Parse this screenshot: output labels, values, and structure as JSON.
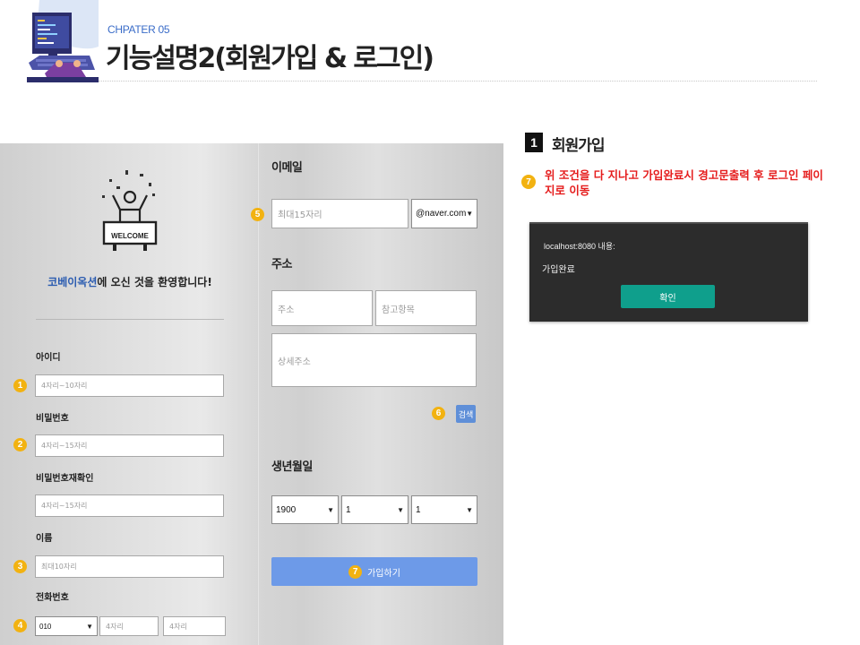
{
  "header": {
    "chapter": "CHPATER 05",
    "title": "기능설명2(회원가입 & 로그인)"
  },
  "signup_form": {
    "welcome_badge": "WELCOME",
    "welcome_brand": "코베이옥션",
    "welcome_rest": "에 오신 것을 환영합니다!",
    "fields": {
      "id": {
        "label": "아이디",
        "placeholder": "4자리~10자리",
        "badge": "1"
      },
      "password": {
        "label": "비밀번호",
        "placeholder": "4자리~15자리",
        "badge": "2"
      },
      "password_confirm": {
        "label": "비밀번호재확인",
        "placeholder": "4자리~15자리"
      },
      "name": {
        "label": "이름",
        "placeholder": "최대10자리",
        "badge": "3"
      },
      "phone": {
        "label": "전화번호",
        "prefix": "010",
        "part2": "4자리",
        "part3": "4자리",
        "badge": "4"
      }
    },
    "email": {
      "label": "이메일",
      "placeholder": "최대15자리",
      "domain": "@naver.com",
      "badge": "5"
    },
    "address": {
      "label": "주소",
      "addr_placeholder": "주소",
      "extra_placeholder": "참고항목",
      "detail_placeholder": "상세주소",
      "search_label": "검색",
      "badge": "6"
    },
    "birth": {
      "label": "생년월일",
      "year": "1900",
      "month": "1",
      "day": "1"
    },
    "submit": {
      "label": "가입하기",
      "badge": "7"
    }
  },
  "panel": {
    "section_num": "1",
    "section_title": "회원가입",
    "note_badge": "7",
    "note": "위 조건을 다 지나고 가입완료시 경고문출력 후 로그인 페이지로 이동",
    "alert": {
      "title": "localhost:8080 내용:",
      "message": "가입완료",
      "ok_label": "확인"
    }
  },
  "colors": {
    "badge": "#f2b211",
    "brand": "#2a5bb0",
    "note": "#e51c1c",
    "join_button": "#6d9ae8",
    "alert_bg": "#2c2c2c",
    "alert_ok": "#0f9f8c"
  }
}
